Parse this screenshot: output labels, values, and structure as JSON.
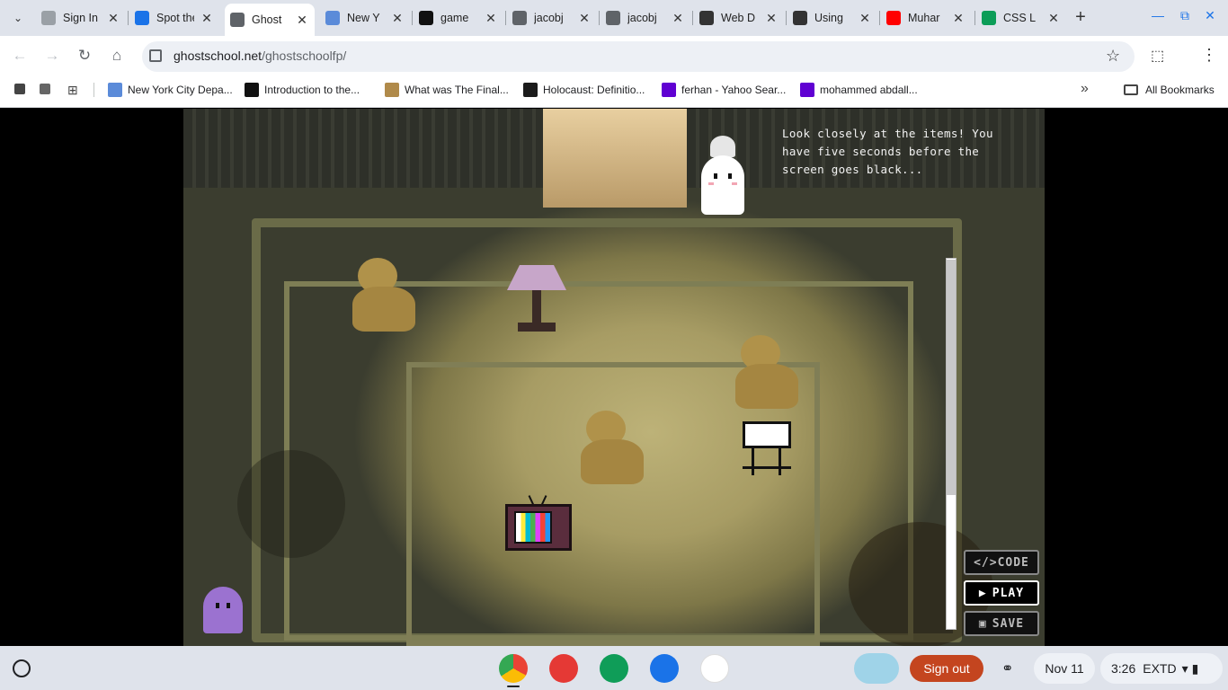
{
  "tabs": [
    {
      "title": "Sign In",
      "favicon": "shield-icon",
      "color": "#9aa0a6"
    },
    {
      "title": "Spot the",
      "favicon": "classroom-icon",
      "color": "#1a73e8"
    },
    {
      "title": "Ghost",
      "favicon": "globe-icon",
      "color": "#5f6368",
      "active": true
    },
    {
      "title": "New Y",
      "favicon": "nyc-icon",
      "color": "#5b8bd9"
    },
    {
      "title": "game",
      "favicon": "github-icon",
      "color": "#111111"
    },
    {
      "title": "jacobj",
      "favicon": "globe-icon",
      "color": "#5f6368"
    },
    {
      "title": "jacobj",
      "favicon": "globe-icon",
      "color": "#5f6368"
    },
    {
      "title": "Web D",
      "favicon": "w3-icon",
      "color": "#333333"
    },
    {
      "title": "Using",
      "favicon": "w3-icon",
      "color": "#333333"
    },
    {
      "title": "Muhar",
      "favicon": "youtube-icon",
      "color": "#ff0000"
    },
    {
      "title": "CSS L",
      "favicon": "w-icon",
      "color": "#0c9d58"
    }
  ],
  "address": {
    "host": "ghostschool.net",
    "path": "/ghostschoolfp/"
  },
  "bookmarks": [
    {
      "label": "New York City Depa...",
      "icon": "nyc-icon",
      "color": "#5b8bd9"
    },
    {
      "label": "Introduction to the...",
      "icon": "book-icon",
      "color": "#111111"
    },
    {
      "label": "What was The Final...",
      "icon": "image-icon",
      "color": "#b08a4a"
    },
    {
      "label": "Holocaust: Definitio...",
      "icon": "h-icon",
      "color": "#1b1b1b"
    },
    {
      "label": "ferhan - Yahoo Sear...",
      "icon": "yahoo-icon",
      "color": "#6001d2"
    },
    {
      "label": "mohammed abdall...",
      "icon": "yahoo-icon",
      "color": "#6001d2"
    }
  ],
  "bookmarks_overflow": "»",
  "all_bookmarks": "All Bookmarks",
  "game": {
    "dialog": "Look closely at the items! You have five seconds before the screen goes black...",
    "buttons": {
      "code": "</>CODE",
      "play": "PLAY",
      "save": "SAVE"
    }
  },
  "shelf": {
    "apps": [
      {
        "name": "chrome",
        "color": "#34a853"
      },
      {
        "name": "canvas",
        "color": "#e53935"
      },
      {
        "name": "classroom",
        "color": "#0f9d58"
      },
      {
        "name": "files",
        "color": "#1a73e8"
      },
      {
        "name": "play-store",
        "color": "#ffffff"
      }
    ],
    "sign_out": "Sign out",
    "date": "Nov 11",
    "time": "3:26",
    "mode": "EXTD"
  }
}
